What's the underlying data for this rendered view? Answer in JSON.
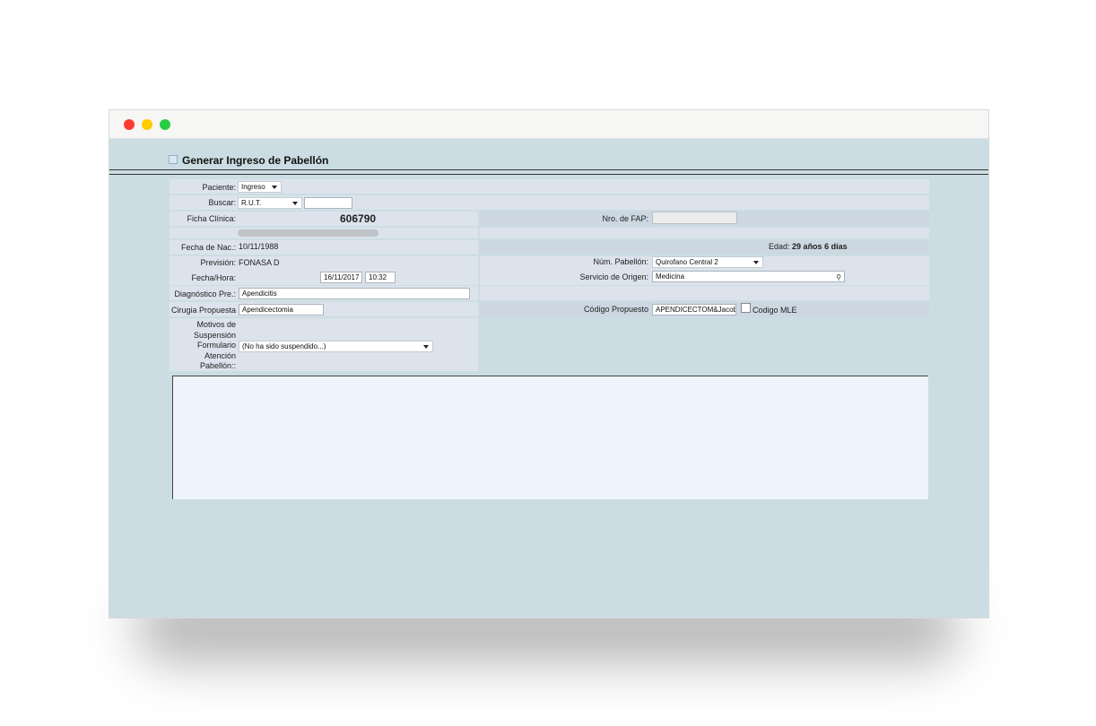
{
  "page": {
    "title": "Generar Ingreso de Pabellón"
  },
  "form": {
    "paciente": {
      "label": "Paciente:",
      "value": "Ingreso"
    },
    "buscar": {
      "label": "Buscar:",
      "type": "R.U.T.",
      "value": ""
    },
    "ficha": {
      "label": "Ficha Clínica:",
      "value": "606790"
    },
    "fap": {
      "label": "Nro. de FAP:",
      "value": ""
    },
    "fecha_nac": {
      "label": "Fecha de Nac.:",
      "value": "10/11/1988"
    },
    "edad": {
      "label": "Edad:",
      "value": "29 años 6 días"
    },
    "prevision": {
      "label": "Previsión:",
      "value": "FONASA D"
    },
    "pabellon": {
      "label": "Núm. Pabellón:",
      "value": "Quirofano Central 2"
    },
    "fecha_hora": {
      "label": "Fecha/Hora:",
      "date": "16/11/2017",
      "time": "10:32"
    },
    "servicio": {
      "label": "Servicio de Origen:",
      "value": "Medicina"
    },
    "diagnostico": {
      "label": "Diagnóstico Pre.:",
      "value": "Apendicitis"
    },
    "cirugia": {
      "label": "Cirugia Propuesta",
      "value": "Apendicectomia"
    },
    "codigo": {
      "label": "Código Propuesto",
      "value": "APENDICECTOM&Jacob",
      "mle_label": "Codigo MLE"
    },
    "motivos": {
      "label_lines": [
        "Motivos de",
        "Suspensión",
        "Formulario",
        "Atención",
        "Pabellón::"
      ],
      "value": "(No ha sido suspendido...)"
    }
  },
  "icons": {
    "window_close": "red-dot",
    "window_minimize": "yellow-dot",
    "window_zoom": "green-dot",
    "search": "magnifier-icon"
  },
  "colors": {
    "background": "#cbdde2",
    "panel": "#dce3ec",
    "textarea": "#eff5fc"
  }
}
